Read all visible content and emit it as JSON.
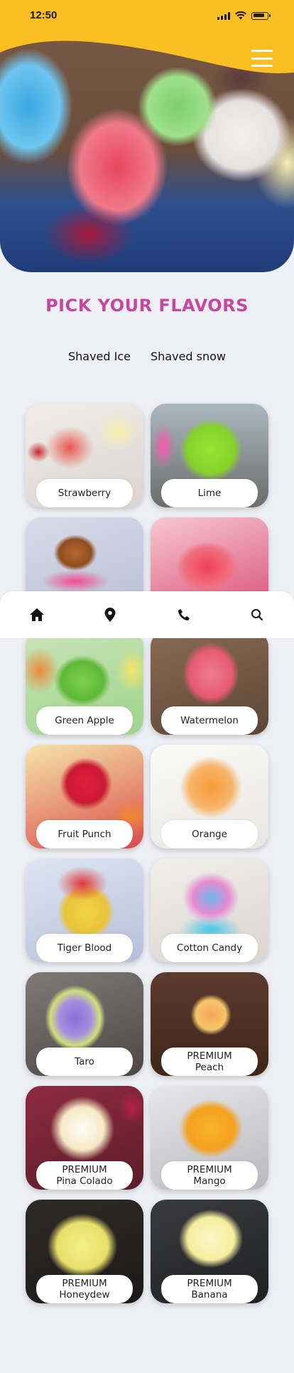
{
  "status": {
    "time": "12:50"
  },
  "colors": {
    "accent": "#fbbf24",
    "title": "#c4489f",
    "background": "#eef0f6"
  },
  "hero": {
    "image": "shaved-ice-hero-photo",
    "menu_icon": "hamburger-menu-icon"
  },
  "heading": "PICK YOUR FLAVORS",
  "tabs": [
    {
      "label": "Shaved Ice"
    },
    {
      "label": "Shaved snow"
    }
  ],
  "flavors": [
    {
      "line1": "Strawberry",
      "line2": ""
    },
    {
      "line1": "Lime",
      "line2": ""
    },
    {
      "line1": "",
      "line2": ""
    },
    {
      "line1": "",
      "line2": ""
    },
    {
      "line1": "Green Apple",
      "line2": ""
    },
    {
      "line1": "Watermelon",
      "line2": ""
    },
    {
      "line1": "Fruit Punch",
      "line2": ""
    },
    {
      "line1": "Orange",
      "line2": ""
    },
    {
      "line1": "Tiger Blood",
      "line2": ""
    },
    {
      "line1": "Cotton Candy",
      "line2": ""
    },
    {
      "line1": "Taro",
      "line2": ""
    },
    {
      "line1": "PREMIUM",
      "line2": "Peach"
    },
    {
      "line1": "PREMIUM",
      "line2": "Pina Colado"
    },
    {
      "line1": "PREMIUM",
      "line2": "Mango"
    },
    {
      "line1": "PREMIUM",
      "line2": "Honeydew"
    },
    {
      "line1": "PREMIUM",
      "line2": "Banana"
    }
  ],
  "nav": [
    {
      "icon": "home-icon"
    },
    {
      "icon": "location-pin-icon"
    },
    {
      "icon": "phone-icon"
    },
    {
      "icon": "search-icon"
    }
  ]
}
